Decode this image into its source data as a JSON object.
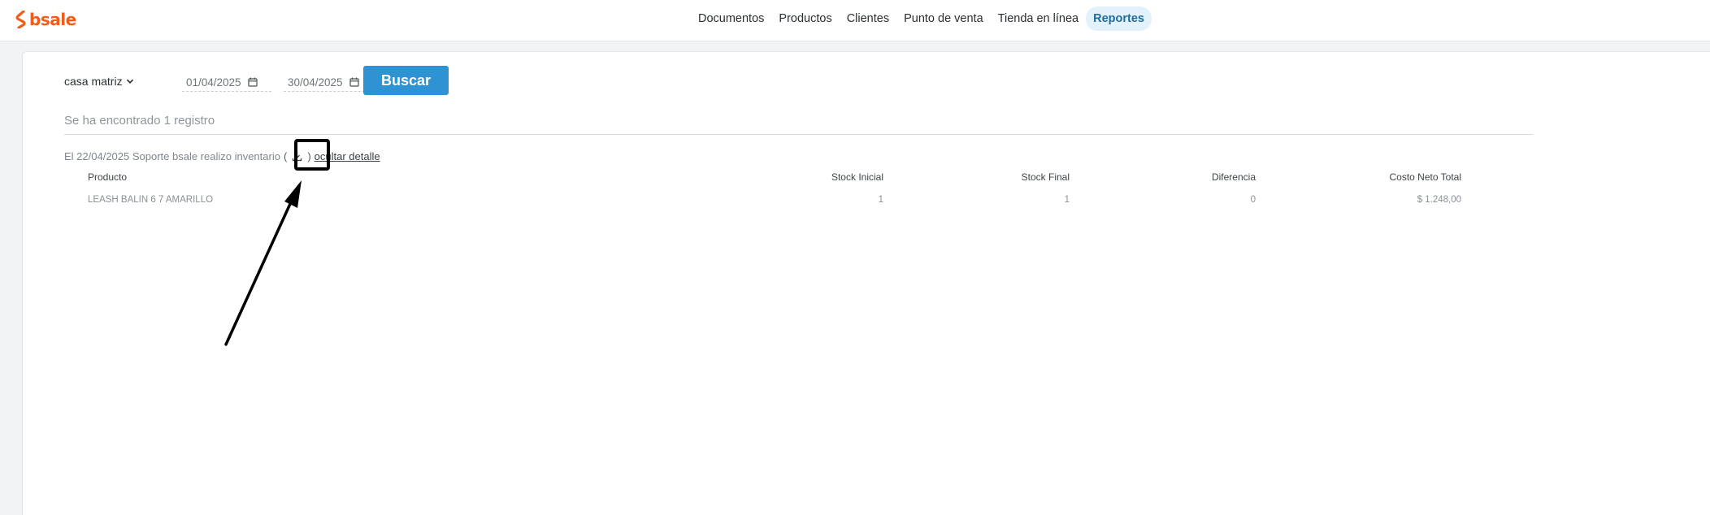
{
  "brand": {
    "name": "bsale",
    "color": "#f25c19"
  },
  "nav": {
    "items": [
      {
        "label": "Documentos"
      },
      {
        "label": "Productos"
      },
      {
        "label": "Clientes"
      },
      {
        "label": "Punto de venta"
      },
      {
        "label": "Tienda en línea"
      },
      {
        "label": "Reportes",
        "active": true
      }
    ]
  },
  "filters": {
    "branch": "casa matriz",
    "date_from": "01/04/2025",
    "date_to": "30/04/2025",
    "search_label": "Buscar",
    "accent": "#2f93d3"
  },
  "results": {
    "summary": "Se ha encontrado 1 registro",
    "record": {
      "description": "El 22/04/2025 Soporte bsale realizo inventario",
      "download_open": "(",
      "download_close": ")",
      "download_icon": "download-icon",
      "hide_detail": "ocultar detalle"
    },
    "table": {
      "headers": {
        "product": "Producto",
        "stock_initial": "Stock Inicial",
        "stock_final": "Stock Final",
        "difference": "Diferencia",
        "net_cost": "Costo Neto Total"
      },
      "rows": [
        {
          "product": "LEASH BALIN 6 7 AMARILLO",
          "stock_initial": "1",
          "stock_final": "1",
          "difference": "0",
          "net_cost": "$ 1.248,00"
        }
      ]
    }
  }
}
